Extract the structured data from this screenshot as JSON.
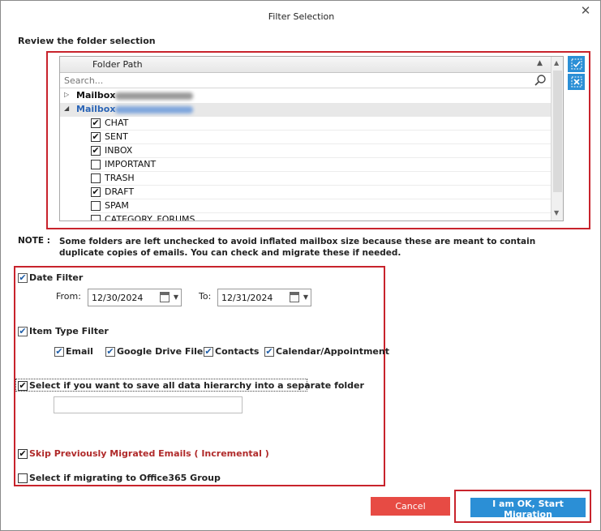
{
  "dialog": {
    "title": "Filter Selection",
    "close_glyph": "✕"
  },
  "folder_section": {
    "label": "Review the folder selection",
    "column_header": "Folder Path",
    "search_placeholder": "Search...",
    "mailboxes": [
      {
        "label": "Mailbox",
        "expanded": false
      },
      {
        "label": "Mailbox",
        "expanded": true
      }
    ],
    "folders": [
      {
        "label": "CHAT",
        "checked": true
      },
      {
        "label": "SENT",
        "checked": true
      },
      {
        "label": "INBOX",
        "checked": true
      },
      {
        "label": "IMPORTANT",
        "checked": false
      },
      {
        "label": "TRASH",
        "checked": false
      },
      {
        "label": "DRAFT",
        "checked": true
      },
      {
        "label": "SPAM",
        "checked": false
      },
      {
        "label": "CATEGORY_FORUMS",
        "checked": false
      }
    ]
  },
  "note": {
    "label": "NOTE :",
    "text": "Some folders are left unchecked to avoid inflated mailbox size because these are meant to contain duplicate copies of emails. You can check and migrate these if needed."
  },
  "date_filter": {
    "label": "Date Filter",
    "checked": true,
    "from_label": "From:",
    "from_value": "12/30/2024",
    "to_label": "To:",
    "to_value": "12/31/2024"
  },
  "item_type_filter": {
    "label": "Item Type Filter",
    "checked": true,
    "items": [
      {
        "label": "Email",
        "checked": true
      },
      {
        "label": "Google Drive Files",
        "checked": true
      },
      {
        "label": "Contacts",
        "checked": true
      },
      {
        "label": "Calendar/Appointment",
        "checked": true
      }
    ]
  },
  "hierarchy_option": {
    "label": "Select if you want to save all data hierarchy into a separate folder",
    "checked": true,
    "folder_value": ""
  },
  "incremental_option": {
    "label": "Skip Previously Migrated Emails ( Incremental )",
    "checked": true
  },
  "office365_group_option": {
    "label": "Select if migrating to Office365 Group",
    "checked": false
  },
  "buttons": {
    "cancel": "Cancel",
    "start": "I am OK, Start Migration"
  },
  "colors": {
    "accent_blue": "#2b8fd6",
    "cancel_red": "#e74b44",
    "highlight_red": "#c8232c",
    "mailbox_blue": "#2a64b6"
  }
}
